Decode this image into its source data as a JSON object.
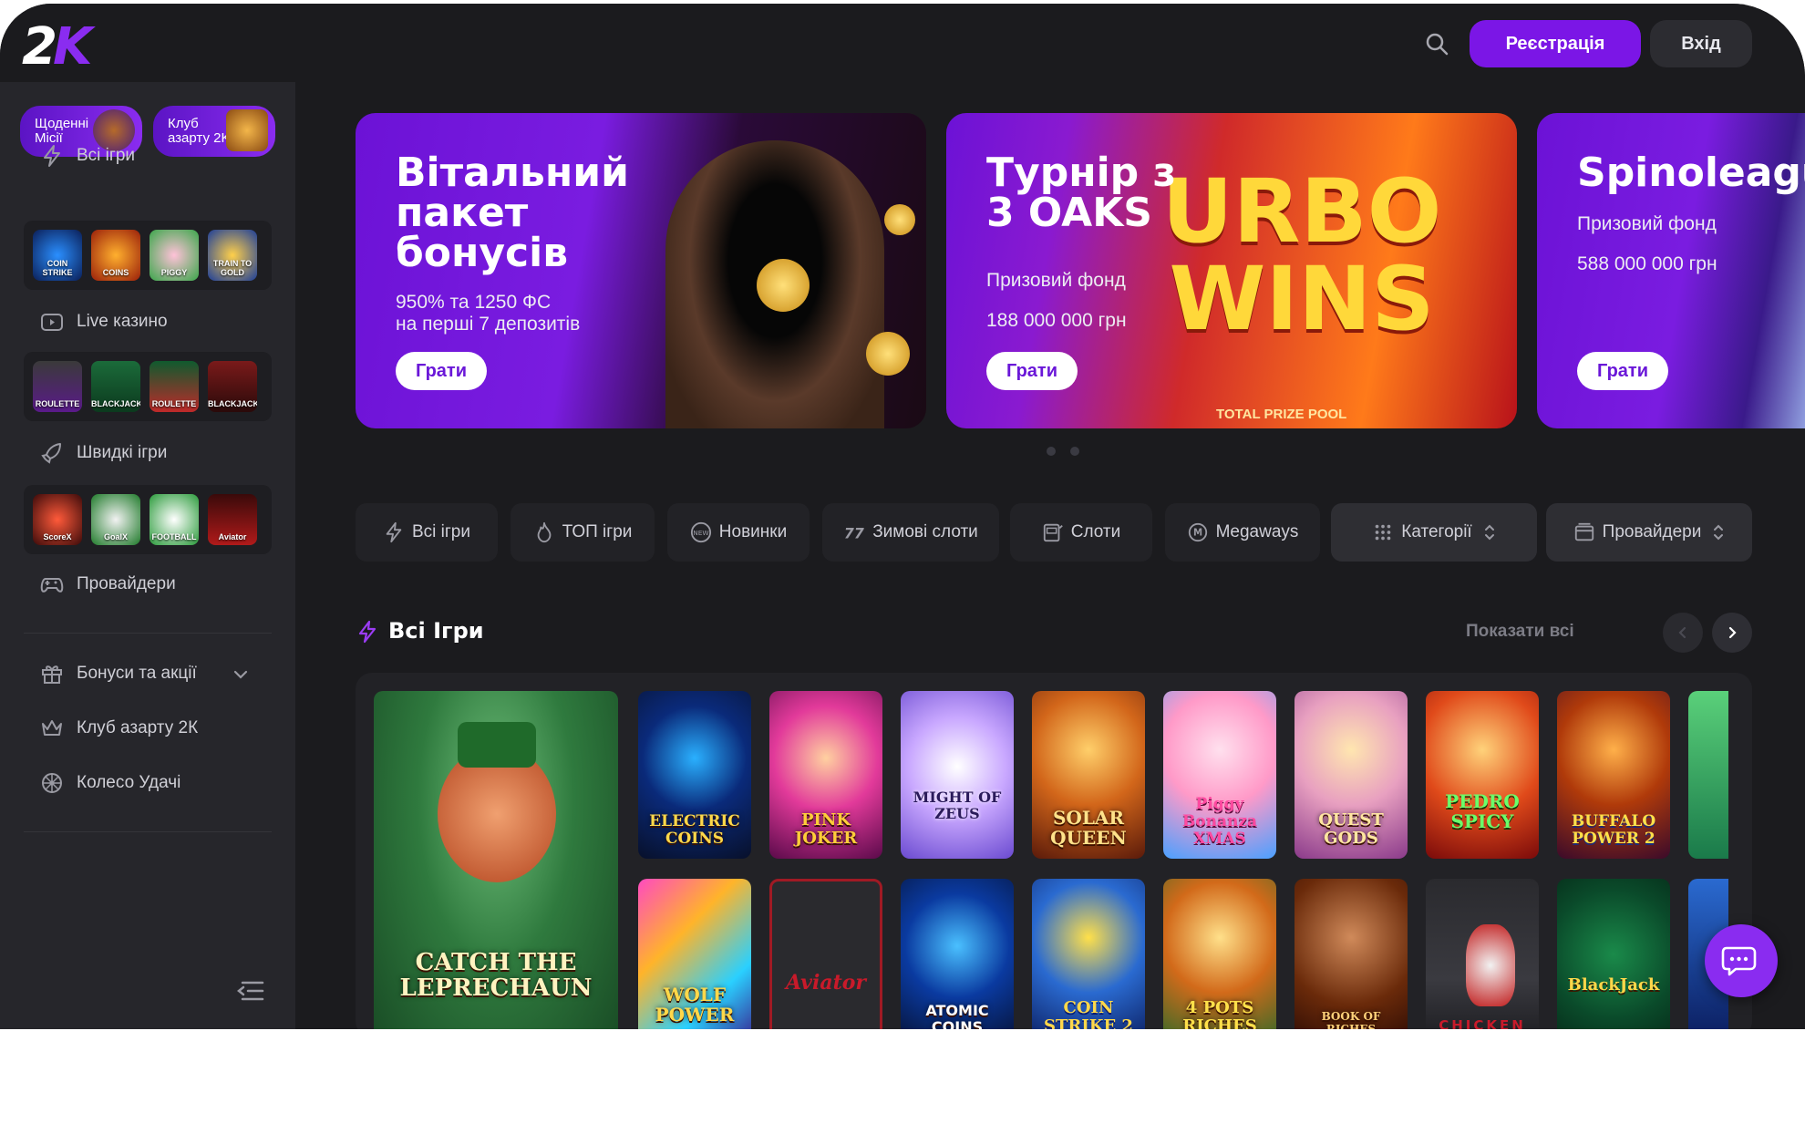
{
  "header": {
    "logo_text": "2K",
    "register_label": "Реєстрація",
    "login_label": "Вхід"
  },
  "sidebar": {
    "promos": [
      {
        "label": "Щоденні Місії"
      },
      {
        "label": "Клуб азарту 2K"
      }
    ],
    "items": [
      {
        "label": "Всі ігри"
      },
      {
        "label": "Live казино"
      },
      {
        "label": "Швидкі ігри"
      },
      {
        "label": "Провайдери"
      },
      {
        "label": "Бонуси та акції"
      },
      {
        "label": "Клуб азарту 2К"
      },
      {
        "label": "Колесо Удачі"
      }
    ],
    "all_games_thumbs": [
      "COIN STRIKE",
      "COINS",
      "PIGGY",
      "TRAIN TO GOLD"
    ],
    "live_thumbs": [
      "ROULETTE",
      "BLACKJACK",
      "ROULETTE",
      "BLACKJACK"
    ],
    "fast_thumbs": [
      "ScoreX",
      "GoalX",
      "FOOTBALL",
      "Aviator"
    ]
  },
  "banners": [
    {
      "title": "Вітальний пакет бонусів",
      "sub": "950% та 1250 ФС\nна перші 7 депозитів",
      "play": "Грати"
    },
    {
      "title": "Турнір з 3 OAKS",
      "sub1": "Призовий фонд",
      "sub2": "188 000 000 грн",
      "play": "Грати",
      "art_text": "URBO WINS",
      "art_caption": "TOTAL PRIZE POOL"
    },
    {
      "title": "Spinoleague",
      "sub1": "Призовий фонд",
      "sub2": "588 000 000 грн",
      "play": "Грати"
    }
  ],
  "filters": [
    {
      "label": "Всі ігри"
    },
    {
      "label": "ТОП ігри"
    },
    {
      "label": "Новинки"
    },
    {
      "label": "Зимові слоти"
    },
    {
      "label": "Слоти"
    },
    {
      "label": "Megaways"
    },
    {
      "label": "Категорії"
    },
    {
      "label": "Провайдери"
    }
  ],
  "games_section": {
    "title": "Всі Ігри",
    "show_all": "Показати всі"
  },
  "games": [
    {
      "name": "CATCH THE LEPRECHAUN"
    },
    {
      "name": "ELECTRIC COINS"
    },
    {
      "name": "PINK JOKER"
    },
    {
      "name": "MIGHT OF ZEUS"
    },
    {
      "name": "SOLAR QUEEN"
    },
    {
      "name": "Piggy Bonanza XMAS"
    },
    {
      "name": "QUEST GODS"
    },
    {
      "name": "PEDRO SPICY"
    },
    {
      "name": "BUFFALO POWER 2"
    },
    {
      "name": "WOLF POWER"
    },
    {
      "name": "Aviator"
    },
    {
      "name": "ATOMIC COINS"
    },
    {
      "name": "COIN STRIKE 2"
    },
    {
      "name": "4 POTS RICHES"
    },
    {
      "name": "BOOK OF RICHES"
    },
    {
      "name": "CHICKEN"
    },
    {
      "name": "BlackJack"
    }
  ]
}
